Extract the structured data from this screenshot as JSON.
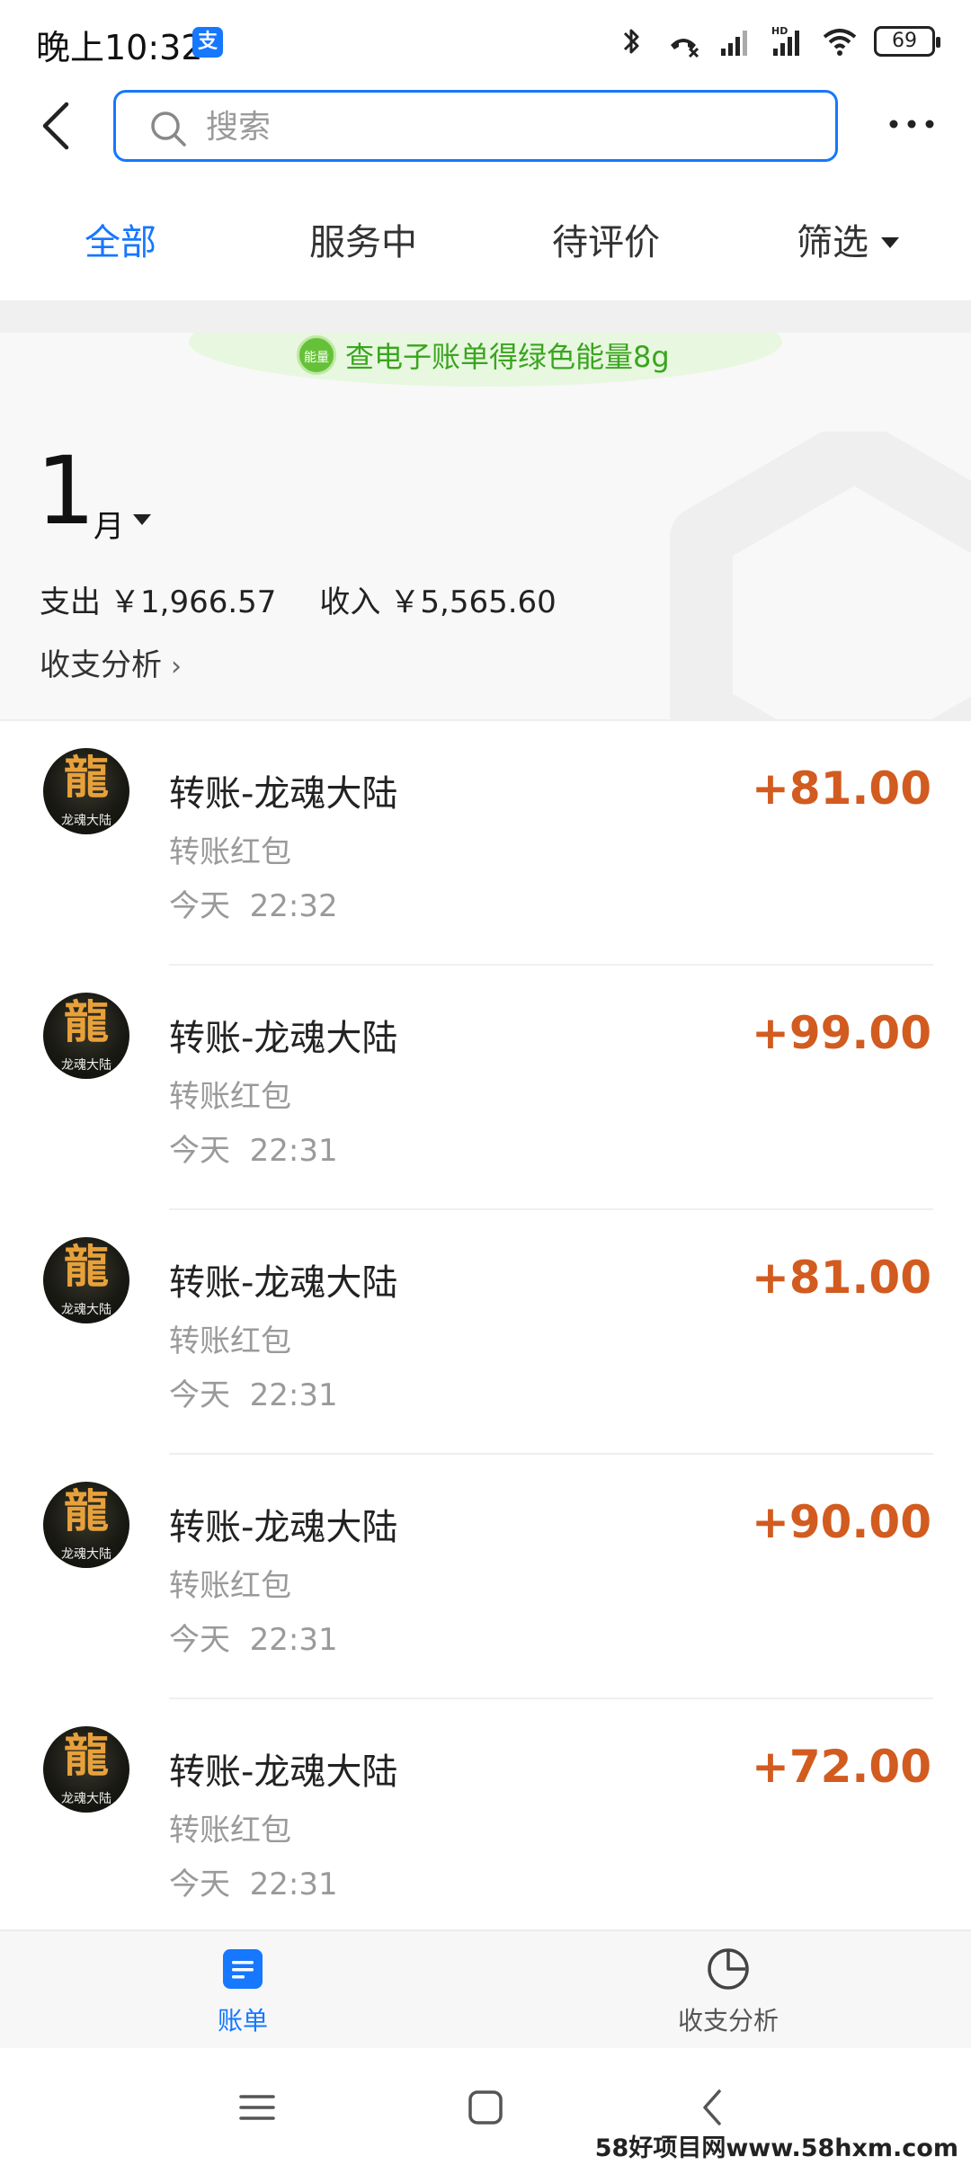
{
  "status_bar": {
    "time": "晚上10:32",
    "app_badge": "支",
    "battery": "69"
  },
  "nav": {
    "search_placeholder": "搜索"
  },
  "tabs": [
    {
      "label": "全部",
      "active": true
    },
    {
      "label": "服务中",
      "active": false
    },
    {
      "label": "待评价",
      "active": false
    },
    {
      "label": "筛选",
      "active": false
    }
  ],
  "banner": {
    "badge": "能量",
    "text": "查电子账单得绿色能量8g"
  },
  "summary": {
    "month_number": "1",
    "month_unit": "月",
    "expense_label": "支出",
    "expense_value": "￥1,966.57",
    "income_label": "收入",
    "income_value": "￥5,565.60",
    "analysis_link": "收支分析"
  },
  "transactions": [
    {
      "avatar_glyph": "龍",
      "avatar_label": "龙魂大陆",
      "title": "转账-龙魂大陆",
      "subtitle": "转账红包",
      "day": "今天",
      "time": "22:32",
      "amount": "+81.00"
    },
    {
      "avatar_glyph": "龍",
      "avatar_label": "龙魂大陆",
      "title": "转账-龙魂大陆",
      "subtitle": "转账红包",
      "day": "今天",
      "time": "22:31",
      "amount": "+99.00"
    },
    {
      "avatar_glyph": "龍",
      "avatar_label": "龙魂大陆",
      "title": "转账-龙魂大陆",
      "subtitle": "转账红包",
      "day": "今天",
      "time": "22:31",
      "amount": "+81.00"
    },
    {
      "avatar_glyph": "龍",
      "avatar_label": "龙魂大陆",
      "title": "转账-龙魂大陆",
      "subtitle": "转账红包",
      "day": "今天",
      "time": "22:31",
      "amount": "+90.00"
    },
    {
      "avatar_glyph": "龍",
      "avatar_label": "龙魂大陆",
      "title": "转账-龙魂大陆",
      "subtitle": "转账红包",
      "day": "今天",
      "time": "22:31",
      "amount": "+72.00"
    }
  ],
  "bottom_tabs": [
    {
      "label": "账单",
      "icon": "bill-icon",
      "active": true
    },
    {
      "label": "收支分析",
      "icon": "pie-chart-icon",
      "active": false
    }
  ],
  "watermark": "58好项目网www.58hxm.com",
  "colors": {
    "accent": "#1677ff",
    "income_amount": "#d25b1f",
    "energy_green": "#3aa51f"
  }
}
